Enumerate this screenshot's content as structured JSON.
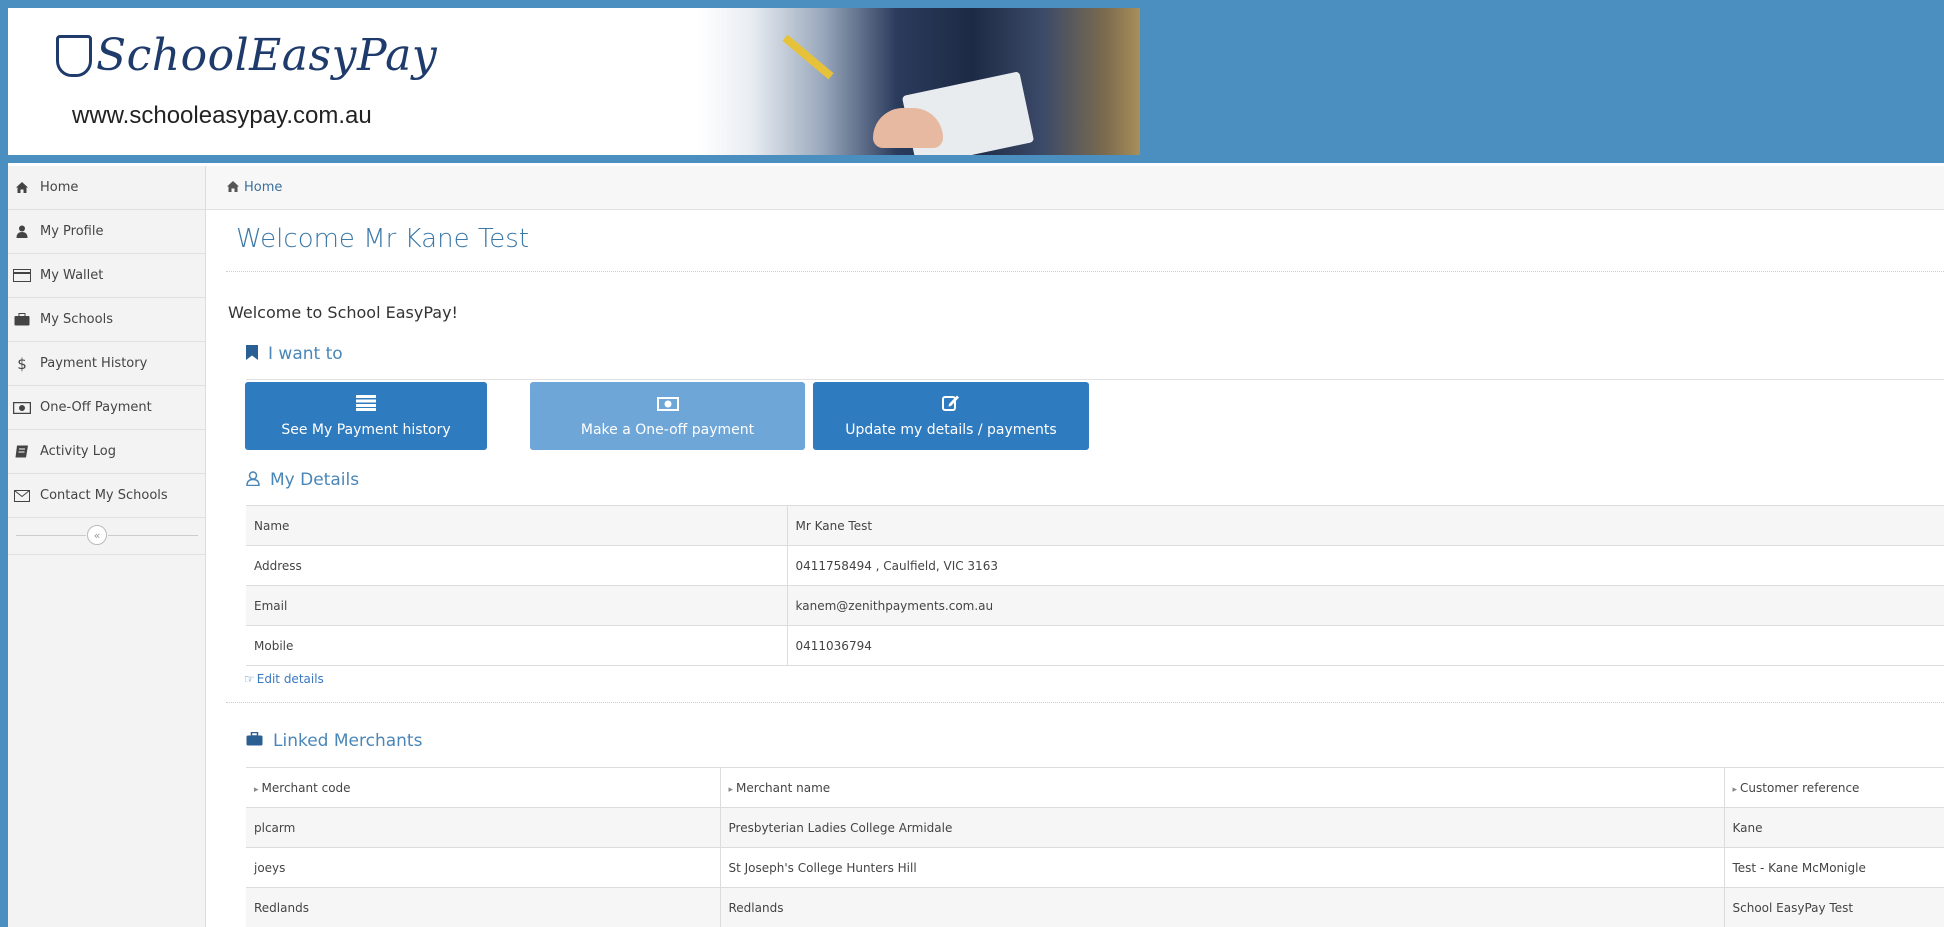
{
  "brand": {
    "name": "SchoolEasyPay",
    "url": "www.schooleasypay.com.au",
    "colors": {
      "header_bg": "#4a8fc0",
      "primary_button": "#2f7bbf",
      "link": "#3a78a8"
    }
  },
  "sidebar": {
    "items": [
      {
        "label": "Home",
        "icon": "home-icon"
      },
      {
        "label": "My Profile",
        "icon": "user-icon"
      },
      {
        "label": "My Wallet",
        "icon": "wallet-icon"
      },
      {
        "label": "My Schools",
        "icon": "briefcase-icon"
      },
      {
        "label": "Payment History",
        "icon": "dollar-icon"
      },
      {
        "label": "One-Off Payment",
        "icon": "money-icon"
      },
      {
        "label": "Activity Log",
        "icon": "book-icon"
      },
      {
        "label": "Contact My Schools",
        "icon": "envelope-icon"
      }
    ],
    "collapse_icon": "«"
  },
  "breadcrumb": {
    "home": "Home"
  },
  "page": {
    "title": "Welcome Mr Kane Test",
    "welcome": "Welcome to School EasyPay!"
  },
  "i_want_to": {
    "heading": "I want to",
    "buttons": [
      {
        "label": "See My Payment history",
        "icon": "list-icon"
      },
      {
        "label": "Make a One-off payment",
        "icon": "money-icon"
      },
      {
        "label": "Update my details / payments",
        "icon": "edit-icon"
      }
    ]
  },
  "my_details": {
    "heading": "My Details",
    "rows": [
      {
        "label": "Name",
        "value": "Mr Kane Test"
      },
      {
        "label": "Address",
        "value": "0411758494 , Caulfield, VIC 3163"
      },
      {
        "label": "Email",
        "value": "kanem@zenithpayments.com.au"
      },
      {
        "label": "Mobile",
        "value": "0411036794"
      }
    ],
    "edit_link": "Edit details"
  },
  "linked_merchants": {
    "heading": "Linked Merchants",
    "columns": [
      "Merchant code",
      "Merchant name",
      "Customer reference"
    ],
    "rows": [
      [
        "plcarm",
        "Presbyterian Ladies College Armidale",
        "Kane"
      ],
      [
        "joeys",
        "St Joseph's College Hunters Hill",
        "Test - Kane McMonigle"
      ],
      [
        "Redlands",
        "Redlands",
        "School EasyPay Test"
      ]
    ]
  }
}
